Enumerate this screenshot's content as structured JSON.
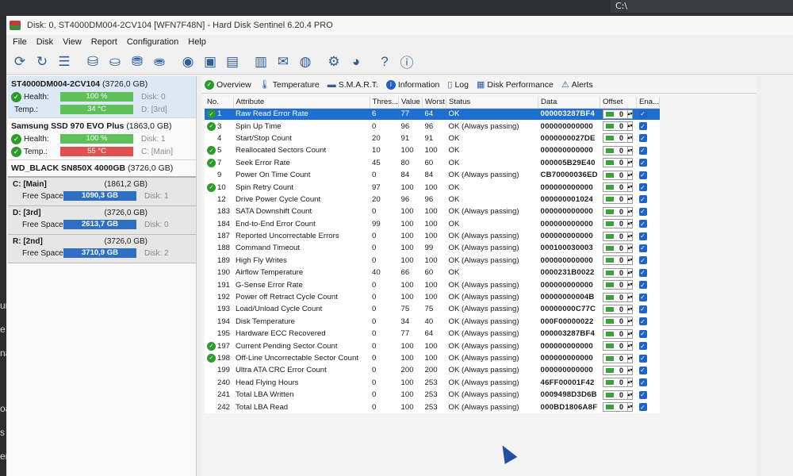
{
  "background": {
    "taskbox_text": "C:\\",
    "left_fragments": [
      "urpi",
      "e wi",
      "nalis",
      "oard",
      "s tim",
      "eripti"
    ]
  },
  "window": {
    "title": "Disk: 0, ST4000DM004-2CV104 [WFN7F48N]  -  Hard Disk Sentinel 6.20.4 PRO"
  },
  "menu": [
    "File",
    "Disk",
    "View",
    "Report",
    "Configuration",
    "Help"
  ],
  "toolbar_icons": [
    "refresh-icon",
    "refresh-all-icon",
    "list-icon",
    "disk-test-icon",
    "disk-surface-icon",
    "disk-check-icon",
    "disk-settings-icon",
    "disk-info-icon",
    "disk-erase-icon",
    "disk-image-icon",
    "report-icon",
    "email-icon",
    "network-icon",
    "gear-icon",
    "sound-icon",
    "help-icon",
    "info-icon"
  ],
  "disks": [
    {
      "name": "ST4000DM004-2CV104",
      "size": "(3726,0 GB)",
      "health_label": "Health:",
      "health": "100 %",
      "disk_label": "Disk: 0",
      "temp_label": "Temp.:",
      "temp": "34 °C",
      "drive_label": "D: [3rd]"
    },
    {
      "name": "Samsung SSD 970 EVO Plus",
      "size": "(1863,0 GB)",
      "health_label": "Health:",
      "health": "100 %",
      "disk_label": "Disk: 1",
      "temp_label": "Temp.:",
      "temp": "55 °C",
      "drive_label": "C: [Main]"
    },
    {
      "name": "WD_BLACK SN850X 4000GB",
      "size": "(3726,0 GB)"
    }
  ],
  "partitions": [
    {
      "name": "C: [Main]",
      "size": "(1861,2 GB)",
      "free_label": "Free Space",
      "free": "1090,3 GB",
      "disk": "Disk: 1"
    },
    {
      "name": "D: [3rd]",
      "size": "(3726,0 GB)",
      "free_label": "Free Space",
      "free": "2613,7 GB",
      "disk": "Disk: 0"
    },
    {
      "name": "R: [2nd]",
      "size": "(3726,0 GB)",
      "free_label": "Free Space",
      "free": "3710,9 GB",
      "disk": "Disk: 2"
    }
  ],
  "tabs": [
    {
      "label": "Overview",
      "icon": "check-icon"
    },
    {
      "label": "Temperature",
      "icon": "thermometer-icon"
    },
    {
      "label": "S.M.A.R.T.",
      "icon": "smart-icon"
    },
    {
      "label": "Information",
      "icon": "info-icon"
    },
    {
      "label": "Log",
      "icon": "log-icon"
    },
    {
      "label": "Disk Performance",
      "icon": "performance-icon"
    },
    {
      "label": "Alerts",
      "icon": "alerts-icon"
    }
  ],
  "table": {
    "headers": [
      "No.",
      "Attribute",
      "Thres...",
      "Value",
      "Worst",
      "Status",
      "Data",
      "Offset",
      "Ena..."
    ],
    "rows": [
      {
        "no": "1",
        "attr": "Raw Read Error Rate",
        "thr": "6",
        "val": "77",
        "worst": "64",
        "status": "OK",
        "data": "000003287BF4",
        "offset": "0",
        "check": true
      },
      {
        "no": "3",
        "attr": "Spin Up Time",
        "thr": "0",
        "val": "96",
        "worst": "96",
        "status": "OK (Always passing)",
        "data": "000000000000",
        "offset": "0",
        "check": true
      },
      {
        "no": "4",
        "attr": "Start/Stop Count",
        "thr": "20",
        "val": "91",
        "worst": "91",
        "status": "OK",
        "data": "0000000027DE",
        "offset": "0",
        "check": false
      },
      {
        "no": "5",
        "attr": "Reallocated Sectors Count",
        "thr": "10",
        "val": "100",
        "worst": "100",
        "status": "OK",
        "data": "000000000000",
        "offset": "0",
        "check": true
      },
      {
        "no": "7",
        "attr": "Seek Error Rate",
        "thr": "45",
        "val": "80",
        "worst": "60",
        "status": "OK",
        "data": "000005B29E40",
        "offset": "0",
        "check": true
      },
      {
        "no": "9",
        "attr": "Power On Time Count",
        "thr": "0",
        "val": "84",
        "worst": "84",
        "status": "OK (Always passing)",
        "data": "CB70000036ED",
        "offset": "0",
        "check": false
      },
      {
        "no": "10",
        "attr": "Spin Retry Count",
        "thr": "97",
        "val": "100",
        "worst": "100",
        "status": "OK",
        "data": "000000000000",
        "offset": "0",
        "check": true
      },
      {
        "no": "12",
        "attr": "Drive Power Cycle Count",
        "thr": "20",
        "val": "96",
        "worst": "96",
        "status": "OK",
        "data": "000000001024",
        "offset": "0",
        "check": false
      },
      {
        "no": "183",
        "attr": "SATA Downshift Count",
        "thr": "0",
        "val": "100",
        "worst": "100",
        "status": "OK (Always passing)",
        "data": "000000000000",
        "offset": "0",
        "check": false
      },
      {
        "no": "184",
        "attr": "End-to-End Error Count",
        "thr": "99",
        "val": "100",
        "worst": "100",
        "status": "OK",
        "data": "000000000000",
        "offset": "0",
        "check": false
      },
      {
        "no": "187",
        "attr": "Reported Uncorrectable Errors",
        "thr": "0",
        "val": "100",
        "worst": "100",
        "status": "OK (Always passing)",
        "data": "000000000000",
        "offset": "0",
        "check": false
      },
      {
        "no": "188",
        "attr": "Command Timeout",
        "thr": "0",
        "val": "100",
        "worst": "99",
        "status": "OK (Always passing)",
        "data": "000100030003",
        "offset": "0",
        "check": false
      },
      {
        "no": "189",
        "attr": "High Fly Writes",
        "thr": "0",
        "val": "100",
        "worst": "100",
        "status": "OK (Always passing)",
        "data": "000000000000",
        "offset": "0",
        "check": false
      },
      {
        "no": "190",
        "attr": "Airflow Temperature",
        "thr": "40",
        "val": "66",
        "worst": "60",
        "status": "OK",
        "data": "0000231B0022",
        "offset": "0",
        "check": false
      },
      {
        "no": "191",
        "attr": "G-Sense Error Rate",
        "thr": "0",
        "val": "100",
        "worst": "100",
        "status": "OK (Always passing)",
        "data": "000000000000",
        "offset": "0",
        "check": false
      },
      {
        "no": "192",
        "attr": "Power off Retract Cycle Count",
        "thr": "0",
        "val": "100",
        "worst": "100",
        "status": "OK (Always passing)",
        "data": "00000000004B",
        "offset": "0",
        "check": false
      },
      {
        "no": "193",
        "attr": "Load/Unload Cycle Count",
        "thr": "0",
        "val": "75",
        "worst": "75",
        "status": "OK (Always passing)",
        "data": "00000000C77C",
        "offset": "0",
        "check": false
      },
      {
        "no": "194",
        "attr": "Disk Temperature",
        "thr": "0",
        "val": "34",
        "worst": "40",
        "status": "OK (Always passing)",
        "data": "000F00000022",
        "offset": "0",
        "check": false
      },
      {
        "no": "195",
        "attr": "Hardware ECC Recovered",
        "thr": "0",
        "val": "77",
        "worst": "64",
        "status": "OK (Always passing)",
        "data": "000003287BF4",
        "offset": "0",
        "check": false
      },
      {
        "no": "197",
        "attr": "Current Pending Sector Count",
        "thr": "0",
        "val": "100",
        "worst": "100",
        "status": "OK (Always passing)",
        "data": "000000000000",
        "offset": "0",
        "check": true
      },
      {
        "no": "198",
        "attr": "Off-Line Uncorrectable Sector Count",
        "thr": "0",
        "val": "100",
        "worst": "100",
        "status": "OK (Always passing)",
        "data": "000000000000",
        "offset": "0",
        "check": true
      },
      {
        "no": "199",
        "attr": "Ultra ATA CRC Error Count",
        "thr": "0",
        "val": "200",
        "worst": "200",
        "status": "OK (Always passing)",
        "data": "000000000000",
        "offset": "0",
        "check": false
      },
      {
        "no": "240",
        "attr": "Head Flying Hours",
        "thr": "0",
        "val": "100",
        "worst": "253",
        "status": "OK (Always passing)",
        "data": "46FF00001F42",
        "offset": "0",
        "check": false
      },
      {
        "no": "241",
        "attr": "Total LBA Written",
        "thr": "0",
        "val": "100",
        "worst": "253",
        "status": "OK (Always passing)",
        "data": "0009498D3D6B",
        "offset": "0",
        "check": false
      },
      {
        "no": "242",
        "attr": "Total LBA Read",
        "thr": "0",
        "val": "100",
        "worst": "253",
        "status": "OK (Always passing)",
        "data": "000BD1806A8F",
        "offset": "0",
        "check": false
      }
    ]
  },
  "colors": {
    "selection": "#1f6fd0",
    "health_green": "#5fbf58",
    "temp_red": "#e24f4f",
    "free_blue": "#2e6fc4",
    "ok_green": "#2e9a2e"
  }
}
